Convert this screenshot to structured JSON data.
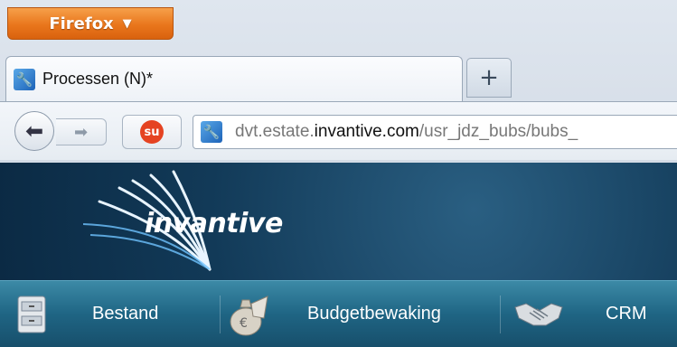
{
  "browser": {
    "menu_button_label": "Firefox",
    "menu_button_arrow": "▼",
    "tab_title": "Processen (N)*",
    "new_tab_label": "+",
    "url_prefix": "dvt.estate.",
    "url_domain": "invantive.com",
    "url_path": "/usr_jdz_bubs/bubs_"
  },
  "site": {
    "logo_text": "invantive"
  },
  "menu": {
    "items": [
      {
        "label": "Bestand",
        "icon": "cabinet-icon"
      },
      {
        "label": "Budgetbewaking",
        "icon": "moneybag-icon"
      },
      {
        "label": "CRM",
        "icon": "handshake-icon"
      }
    ]
  },
  "colors": {
    "firefox_orange": "#e9761c",
    "header_dark_blue": "#123a58",
    "menubar_teal": "#1f6584",
    "stumble_red": "#e54322"
  }
}
